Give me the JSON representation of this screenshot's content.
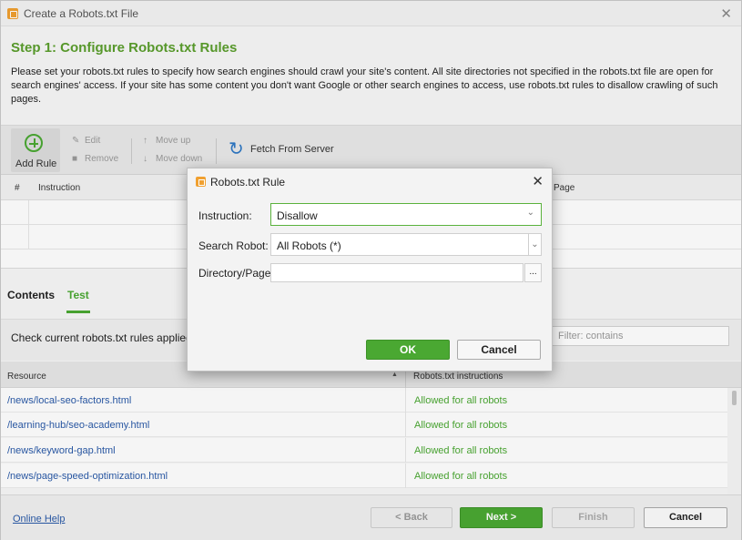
{
  "window": {
    "title": "Create a Robots.txt File",
    "close_icon": "close-icon"
  },
  "header": {
    "step_title": "Step 1: Configure Robots.txt Rules",
    "description": "Please set your robots.txt rules to specify how search engines should crawl your site's content. All site directories not specified in the robots.txt file are open for search engines' access. If your site has some content you don't want Google or other search engines to access, use robots.txt rules to disallow crawling of such pages."
  },
  "toolbar": {
    "add_rule": "Add Rule",
    "edit": "Edit",
    "remove": "Remove",
    "move_up": "Move up",
    "move_down": "Move down",
    "fetch": "Fetch From Server"
  },
  "rules_grid": {
    "columns": [
      "#",
      "Instruction",
      "Page"
    ],
    "rows": [
      {},
      {},
      {}
    ]
  },
  "tabs": [
    {
      "label": "Contents",
      "active": false
    },
    {
      "label": "Test",
      "active": true
    }
  ],
  "test": {
    "check_label": "Check current robots.txt rules applied:",
    "filter_placeholder": "Filter: contains"
  },
  "results": {
    "columns": [
      "Resource",
      "Robots.txt instructions"
    ],
    "sort": "ascending",
    "rows": [
      {
        "resource": "/news/local-seo-factors.html",
        "status": "Allowed for all robots"
      },
      {
        "resource": "/learning-hub/seo-academy.html",
        "status": "Allowed for all robots"
      },
      {
        "resource": "/news/keyword-gap.html",
        "status": "Allowed for all robots"
      },
      {
        "resource": "/news/page-speed-optimization.html",
        "status": "Allowed for all robots"
      }
    ]
  },
  "footer": {
    "help": "Online Help",
    "back": "< Back",
    "next": "Next >",
    "finish": "Finish",
    "cancel": "Cancel"
  },
  "dialog": {
    "title": "Robots.txt Rule",
    "instruction_label": "Instruction:",
    "instruction_value": "Disallow",
    "robot_label": "Search Robot:",
    "robot_value": "All Robots (*)",
    "directory_label": "Directory/Page:",
    "directory_value": "",
    "browse": "...",
    "ok": "OK",
    "cancel": "Cancel"
  },
  "colors": {
    "accent_green": "#4aa832",
    "link_blue": "#2a5aa8",
    "title_green": "#5a9e2c",
    "icon_orange": "#f0a030",
    "fetch_blue": "#2f78c4"
  }
}
